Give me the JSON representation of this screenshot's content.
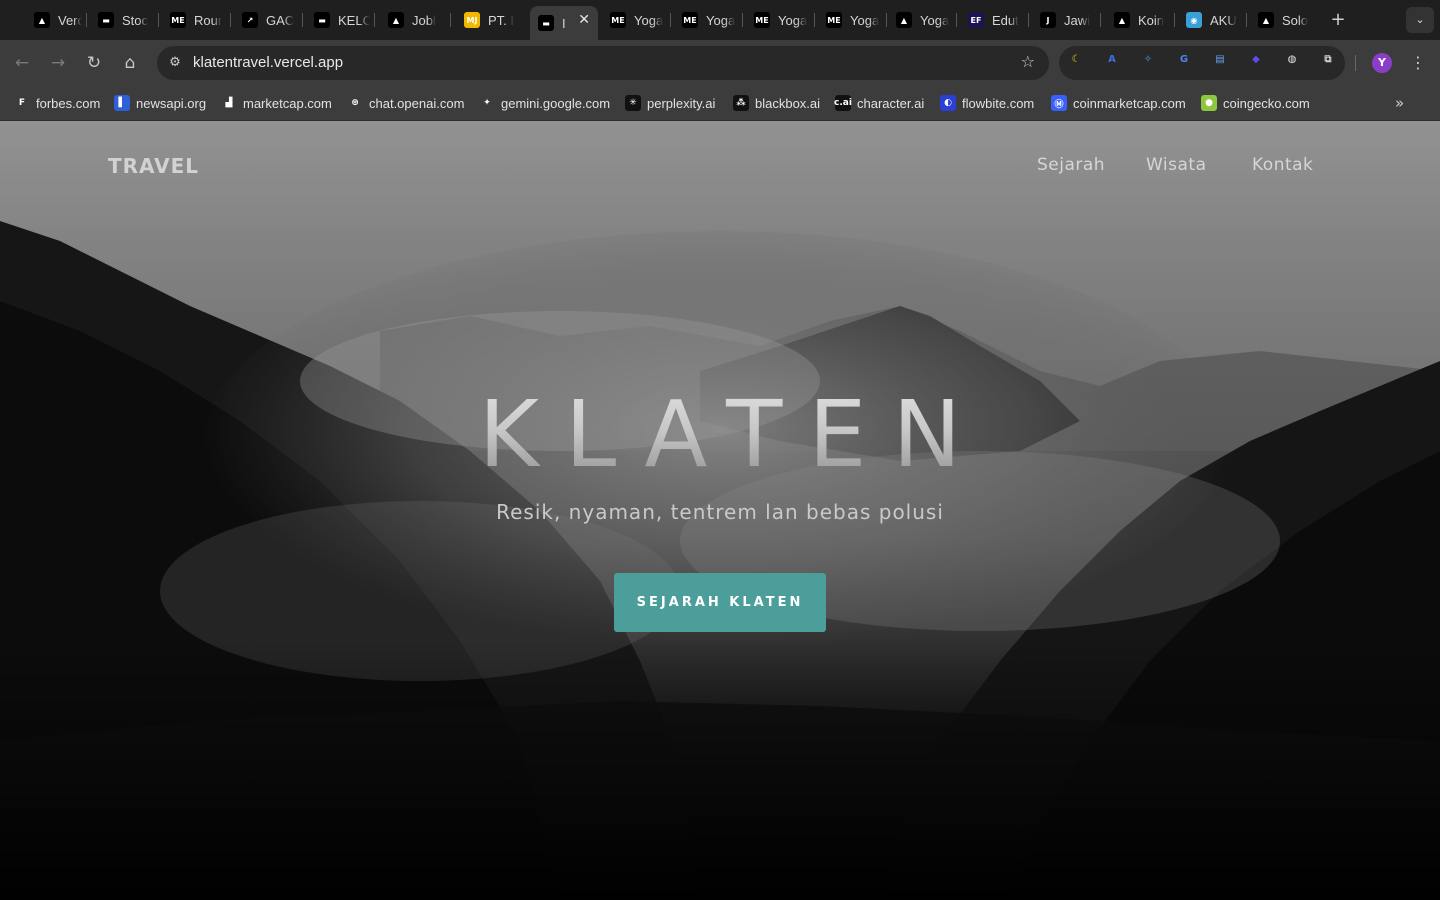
{
  "browser": {
    "tabs": [
      {
        "title": "Verc",
        "favicon": "vercel-triangle",
        "bg": "#000000",
        "glyph": "▲"
      },
      {
        "title": "Stoc",
        "favicon": "dark-bars",
        "bg": "#000000",
        "glyph": "▬"
      },
      {
        "title": "Rour",
        "favicon": "me-logo",
        "bg": "#000000",
        "glyph": "ME"
      },
      {
        "title": "GAC",
        "favicon": "arrow-logo",
        "bg": "#000000",
        "glyph": "↗"
      },
      {
        "title": "KELC",
        "favicon": "dark-bars",
        "bg": "#000000",
        "glyph": "▬"
      },
      {
        "title": "Jobl",
        "favicon": "vercel-triangle",
        "bg": "#000000",
        "glyph": "▲"
      },
      {
        "title": "PT. I",
        "favicon": "mj-logo",
        "bg": "#f5b800",
        "glyph": "MJ"
      },
      {
        "title": "I",
        "favicon": "dark-bars",
        "bg": "#000000",
        "glyph": "▬",
        "active": true
      },
      {
        "title": "Yoga",
        "favicon": "me-logo",
        "bg": "#000000",
        "glyph": "ME"
      },
      {
        "title": "Yoga",
        "favicon": "me-logo",
        "bg": "#000000",
        "glyph": "ME"
      },
      {
        "title": "Yoga",
        "favicon": "me-logo",
        "bg": "#000000",
        "glyph": "ME"
      },
      {
        "title": "Yoga",
        "favicon": "me-logo",
        "bg": "#000000",
        "glyph": "ME"
      },
      {
        "title": "Yoga",
        "favicon": "vercel-triangle",
        "bg": "#000000",
        "glyph": "▲"
      },
      {
        "title": "Edut",
        "favicon": "ef-logo",
        "bg": "#1a1450",
        "glyph": "EF"
      },
      {
        "title": "Jawi",
        "favicon": "j-logo",
        "bg": "#000000",
        "glyph": "J"
      },
      {
        "title": "Koin",
        "favicon": "vercel-triangle",
        "bg": "#000000",
        "glyph": "▲"
      },
      {
        "title": "AKU",
        "favicon": "colorful-logo",
        "bg": "#3aa0d8",
        "glyph": "◉"
      },
      {
        "title": "Solo",
        "favicon": "vercel-triangle",
        "bg": "#000000",
        "glyph": "▲"
      }
    ],
    "new_tab_icon": "plus-icon",
    "tab_search_icon": "chevron-down-icon",
    "url": "klatentravel.vercel.app",
    "profile_initial": "Y",
    "extensions": [
      {
        "name": "moon-extension-icon",
        "color": "#f5d000",
        "glyph": "☾"
      },
      {
        "name": "translate-a-extension-icon",
        "color": "#3b6fe0",
        "glyph": "A"
      },
      {
        "name": "compass-extension-icon",
        "color": "#3ea0f0",
        "glyph": "✧"
      },
      {
        "name": "google-translate-extension-icon",
        "color": "#4a84ee",
        "glyph": "G"
      },
      {
        "name": "docs-extension-icon",
        "color": "#6aa0f0",
        "glyph": "▤"
      },
      {
        "name": "bookmark-extension-icon",
        "color": "#5a4cf0",
        "glyph": "◆"
      },
      {
        "name": "globe-extension-icon",
        "color": "#e8e8e8",
        "glyph": "◍"
      },
      {
        "name": "puzzle-extensions-icon",
        "color": "#cfcfcf",
        "glyph": "⧉"
      }
    ],
    "bookmarks": [
      {
        "label": "forbes.com",
        "favicon": "forbes-icon",
        "bg": "#3c3c3c",
        "glyph": "F"
      },
      {
        "label": "newsapi.org",
        "favicon": "newsapi-icon",
        "bg": "#2f5fd8",
        "glyph": "▌"
      },
      {
        "label": "marketcap.com",
        "favicon": "bars-chart-icon",
        "bg": "#3c3c3c",
        "glyph": "▟"
      },
      {
        "label": "chat.openai.com",
        "favicon": "openai-icon",
        "bg": "#3c3c3c",
        "glyph": "⊛"
      },
      {
        "label": "gemini.google.com",
        "favicon": "gemini-icon",
        "bg": "#3c3c3c",
        "glyph": "✦"
      },
      {
        "label": "perplexity.ai",
        "favicon": "perplexity-icon",
        "bg": "#111111",
        "glyph": "✳"
      },
      {
        "label": "blackbox.ai",
        "favicon": "blackbox-icon",
        "bg": "#111111",
        "glyph": "⁂"
      },
      {
        "label": "character.ai",
        "favicon": "character-ai-icon",
        "bg": "#111111",
        "glyph": "c.ai"
      },
      {
        "label": "flowbite.com",
        "favicon": "flowbite-icon",
        "bg": "#2a3fd8",
        "glyph": "◐"
      },
      {
        "label": "coinmarketcap.com",
        "favicon": "coinmarketcap-icon",
        "bg": "#3861fb",
        "glyph": "Ⓜ"
      },
      {
        "label": "coingecko.com",
        "favicon": "coingecko-icon",
        "bg": "#8dc63f",
        "glyph": "●"
      }
    ]
  },
  "site": {
    "brand": "TRAVEL",
    "nav": [
      "Sejarah",
      "Wisata",
      "Kontak"
    ],
    "hero_title": "KLATEN",
    "hero_subtitle": "Resik, nyaman, tentrem lan bebas polusi",
    "cta_label": "SEJARAH KLATEN",
    "cta_color": "#4b9e99"
  }
}
